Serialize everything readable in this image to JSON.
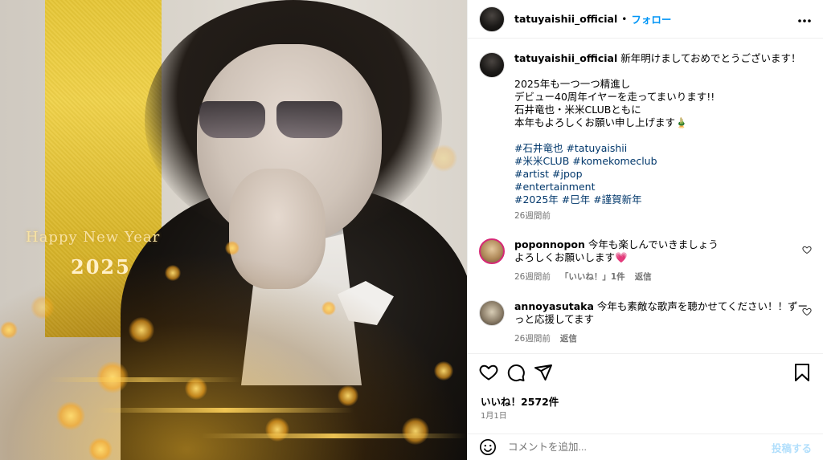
{
  "image": {
    "greeting": "Happy New Year",
    "year": "2025"
  },
  "header": {
    "username": "tatuyaishii_official",
    "separator": "•",
    "follow_label": "フォロー",
    "more_icon": "more-horizontal-icon"
  },
  "caption": {
    "username": "tatuyaishii_official",
    "first_line": "新年明けましておめでとうございます！",
    "lines": [
      "2025年も一つ一つ精進し",
      "デビュー40周年イヤーを走ってまいります!!",
      "石井竜也・米米CLUBともに",
      "本年もよろしくお願い申し上げます🎍"
    ],
    "hashtag_lines": [
      "#石井竜也 #tatuyaishii",
      "#米米CLUB #komekomeclub",
      "#artist #jpop",
      "#entertainment",
      "#2025年 #巳年 #謹賀新年"
    ],
    "time": "26週間前"
  },
  "comments": [
    {
      "username": "poponnopon",
      "text_line1": "今年も楽しんでいきましょう",
      "text_line2": "よろしくお願いします💗",
      "time": "26週間前",
      "likes": "「いいね！」1件",
      "reply": "返信"
    },
    {
      "username": "annoyasutaka",
      "text_line1": "今年も素敵な歌声を聴かせてください！！ずー",
      "text_line2": "っと応援してます",
      "time": "26週間前",
      "reply": "返信"
    }
  ],
  "actions": {
    "like_icon": "heart-icon",
    "comment_icon": "comment-icon",
    "share_icon": "send-icon",
    "save_icon": "bookmark-icon"
  },
  "likes_text": "いいね！2572件",
  "date_text": "1月1日",
  "comment_box": {
    "placeholder": "コメントを追加...",
    "post_label": "投稿する",
    "emoji_icon": "emoji-icon"
  },
  "colors": {
    "accent": "#0095f6",
    "hashtag": "#00376b",
    "muted": "#737373",
    "post_disabled": "#b2dffc"
  }
}
